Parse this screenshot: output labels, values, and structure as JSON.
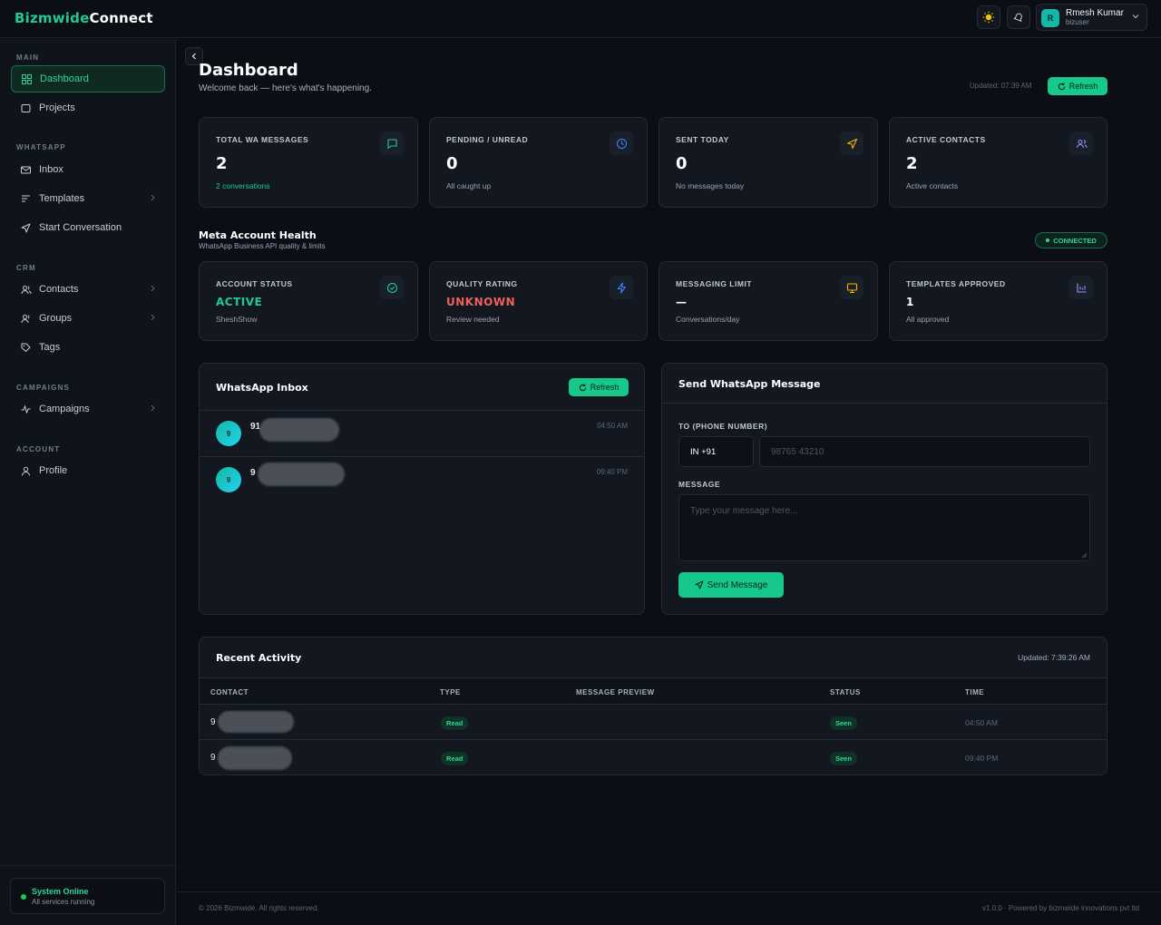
{
  "brand": {
    "part1": "Bizmwide",
    "part2": "Connect",
    "accent": "#22c993"
  },
  "user": {
    "initial": "R",
    "name": "Rmesh Kumar",
    "role": "bizuser"
  },
  "sidebar": {
    "sections": [
      "MAIN",
      "WHATSAPP",
      "CRM",
      "CAMPAIGNS",
      "ACCOUNT"
    ],
    "items": [
      {
        "label": "Dashboard",
        "icon": "grid-icon"
      },
      {
        "label": "Projects",
        "icon": "folder-icon"
      },
      {
        "label": "Inbox",
        "icon": "mail-icon"
      },
      {
        "label": "Templates",
        "icon": "template-icon"
      },
      {
        "label": "Start Conversation",
        "icon": "send-icon"
      },
      {
        "label": "Contacts",
        "icon": "users-icon"
      },
      {
        "label": "Groups",
        "icon": "group-icon"
      },
      {
        "label": "Tags",
        "icon": "tag-icon"
      },
      {
        "label": "Campaigns",
        "icon": "activity-icon"
      },
      {
        "label": "Profile",
        "icon": "user-icon"
      }
    ],
    "status": {
      "title": "System Online",
      "sub": "All services running"
    }
  },
  "header": {
    "title": "Dashboard",
    "subtitle": "Welcome back — here's what's happening.",
    "updated": "Updated: 07:39 AM",
    "refresh": "Refresh"
  },
  "stats": [
    {
      "label": "TOTAL WA MESSAGES",
      "value": "2",
      "sub": "2 conversations",
      "icon": "chat-icon",
      "color": "#22c993"
    },
    {
      "label": "PENDING / UNREAD",
      "value": "0",
      "sub": "All caught up",
      "icon": "clock-icon",
      "color": "#3b82f6"
    },
    {
      "label": "SENT TODAY",
      "value": "0",
      "sub": "No messages today",
      "icon": "send-icon",
      "color": "#f5b400"
    },
    {
      "label": "ACTIVE CONTACTS",
      "value": "2",
      "sub": "Active contacts",
      "icon": "users-icon",
      "color": "#a78bfa"
    }
  ],
  "health": {
    "title": "Meta Account Health",
    "subtitle": "WhatsApp Business API quality & limits",
    "badge": "CONNECTED",
    "cards": [
      {
        "label": "ACCOUNT STATUS",
        "value": "ACTIVE",
        "sub": "SheshShow",
        "color": "#22c993",
        "icon": "check-circle-icon"
      },
      {
        "label": "QUALITY RATING",
        "value": "UNKNOWN",
        "sub": "Review needed",
        "color": "#f0605a",
        "icon": "zap-icon"
      },
      {
        "label": "MESSAGING LIMIT",
        "value": "—",
        "sub": "Conversations/day",
        "color": "#ffffff",
        "icon": "monitor-icon"
      },
      {
        "label": "TEMPLATES APPROVED",
        "value": "1",
        "sub": "All approved",
        "color": "#ffffff",
        "icon": "chart-icon"
      }
    ]
  },
  "inbox": {
    "title": "WhatsApp Inbox",
    "refresh": "Refresh",
    "items": [
      {
        "avatar": "9",
        "name": "91",
        "time": "04:50 AM"
      },
      {
        "avatar": "9",
        "name": "9",
        "time": "09:40 PM"
      }
    ]
  },
  "send": {
    "title": "Send WhatsApp Message",
    "to_label": "TO (PHONE NUMBER)",
    "country": "IN +91",
    "phone_placeholder": "98765 43210",
    "message_label": "MESSAGE",
    "message_placeholder": "Type your message here...",
    "button": "Send Message"
  },
  "activity": {
    "title": "Recent Activity",
    "updated": "Updated: 7:39:26 AM",
    "columns": [
      "CONTACT",
      "TYPE",
      "MESSAGE PREVIEW",
      "STATUS",
      "TIME"
    ],
    "rows": [
      {
        "contact": "9",
        "type": "Read",
        "preview": "",
        "status": "Seen",
        "time": "04:50 AM"
      },
      {
        "contact": "9",
        "type": "Read",
        "preview": "",
        "status": "Seen",
        "time": "09:40 PM"
      }
    ]
  },
  "footer": {
    "left": "© 2026 Bizmwide. All rights reserved.",
    "right": "v1.0.0 · Powered by bizmwide innovations pvt ltd"
  }
}
